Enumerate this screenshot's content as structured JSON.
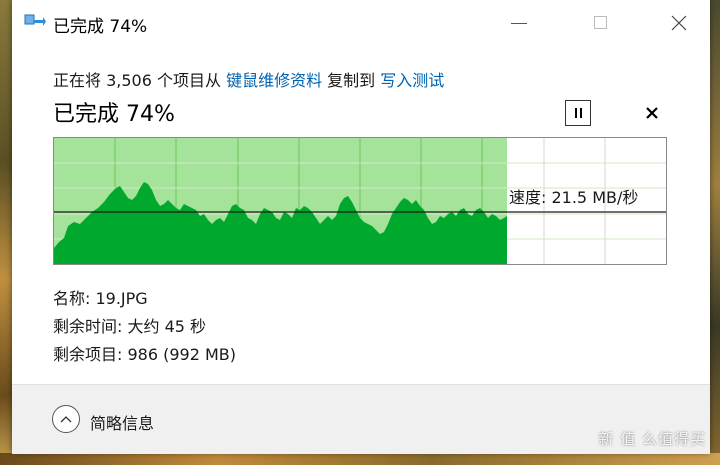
{
  "window": {
    "title": "已完成 74%"
  },
  "copy_line": {
    "prefix": "正在将 3,506 个项目从 ",
    "source": "键鼠维修资料",
    "middle": " 复制到 ",
    "destination": "写入测试"
  },
  "progress": {
    "title": "已完成 74%",
    "fraction": 0.74
  },
  "graph": {
    "speed_label": "速度: 21.5 MB/秒",
    "fill_color": "#00a82d",
    "area_color": "#a6e39a",
    "grid_color": "#6cc35a"
  },
  "details": {
    "name": "名称: 19.JPG",
    "time_remaining": "剩余时间: 大约 45 秒",
    "items_remaining": "剩余项目: 986 (992 MB)"
  },
  "footer": {
    "label": "简略信息"
  },
  "watermark": "新 值 么值得买"
}
